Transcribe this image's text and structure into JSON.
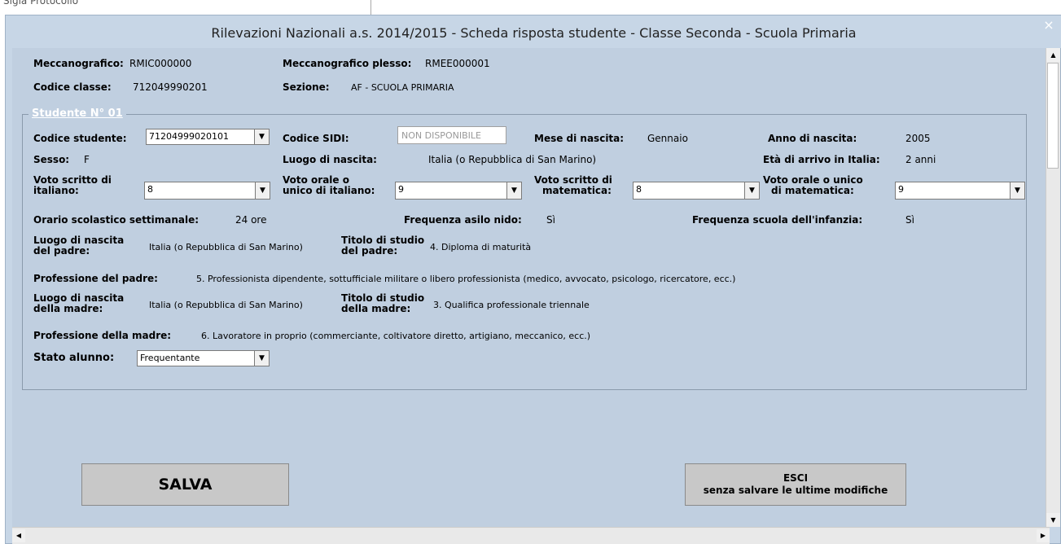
{
  "background_strip": {
    "text": "Sigla Protocollo"
  },
  "window": {
    "title": "Rilevazioni Nazionali a.s. 2014/2015 - Scheda risposta studente - Classe Seconda - Scuola Primaria",
    "close_glyph": "×"
  },
  "header": {
    "meccanografico_label": "Meccanografico:",
    "meccanografico_value": "RMIC000000",
    "plesso_label": "Meccanografico plesso:",
    "plesso_value": "RMEE000001",
    "classe_label": "Codice classe:",
    "classe_value": "712049990201",
    "sezione_label": "Sezione:",
    "sezione_value": "AF - SCUOLA PRIMARIA"
  },
  "student": {
    "frame_title": "Studente N° 01",
    "codice_studente_label": "Codice studente:",
    "codice_studente_value": "71204999020101",
    "codice_sidi_label": "Codice SIDI:",
    "codice_sidi_value": "NON DISPONIBILE",
    "mese_label": "Mese di nascita:",
    "mese_value": "Gennaio",
    "anno_label": "Anno di nascita:",
    "anno_value": "2005",
    "sesso_label": "Sesso:",
    "sesso_value": "F",
    "luogo_label": "Luogo di nascita:",
    "luogo_value": "Italia (o Repubblica di San Marino)",
    "eta_label": "Età di arrivo in Italia:",
    "eta_value": "2 anni",
    "voto_scritto_ita_label_1": "Voto scritto di",
    "voto_scritto_ita_label_2": "italiano:",
    "voto_scritto_ita_value": "8",
    "voto_orale_ita_label_1": "Voto orale o",
    "voto_orale_ita_label_2": "unico di italiano:",
    "voto_orale_ita_value": "9",
    "voto_scritto_mat_label_1": "Voto scritto di",
    "voto_scritto_mat_label_2": "matematica:",
    "voto_scritto_mat_value": "8",
    "voto_orale_mat_label_1": "Voto orale o unico",
    "voto_orale_mat_label_2": "di matematica:",
    "voto_orale_mat_value": "9",
    "orario_label": "Orario scolastico settimanale:",
    "orario_value": "24 ore",
    "asilo_label": "Frequenza asilo nido:",
    "asilo_value": "Sì",
    "infanzia_label": "Frequenza scuola dell'infanzia:",
    "infanzia_value": "Sì",
    "luogo_padre_label_1": "Luogo di nascita",
    "luogo_padre_label_2": "del padre:",
    "luogo_padre_value": "Italia (o Repubblica di San Marino)",
    "titolo_padre_label_1": "Titolo di studio",
    "titolo_padre_label_2": "del padre:",
    "titolo_padre_value": "4. Diploma di maturità",
    "prof_padre_label": "Professione del padre:",
    "prof_padre_value": "5. Professionista dipendente, sottufficiale militare o libero professionista (medico, avvocato, psicologo, ricercatore, ecc.)",
    "luogo_madre_label_1": "Luogo di nascita",
    "luogo_madre_label_2": "della madre:",
    "luogo_madre_value": "Italia (o Repubblica di San Marino)",
    "titolo_madre_label_1": "Titolo di studio",
    "titolo_madre_label_2": "della madre:",
    "titolo_madre_value": "3. Qualifica professionale triennale",
    "prof_madre_label": "Professione della madre:",
    "prof_madre_value": "6. Lavoratore in proprio (commerciante, coltivatore diretto, artigiano, meccanico, ecc.)",
    "stato_label": "Stato alunno:",
    "stato_value": "Frequentante"
  },
  "buttons": {
    "salva_label": "SALVA",
    "esci_label_1": "ESCI",
    "esci_label_2": "senza salvare le ultime modifiche"
  },
  "scroll_glyphs": {
    "up": "▲",
    "down": "▼",
    "left": "◀",
    "right": "▶",
    "combo": "▼"
  }
}
